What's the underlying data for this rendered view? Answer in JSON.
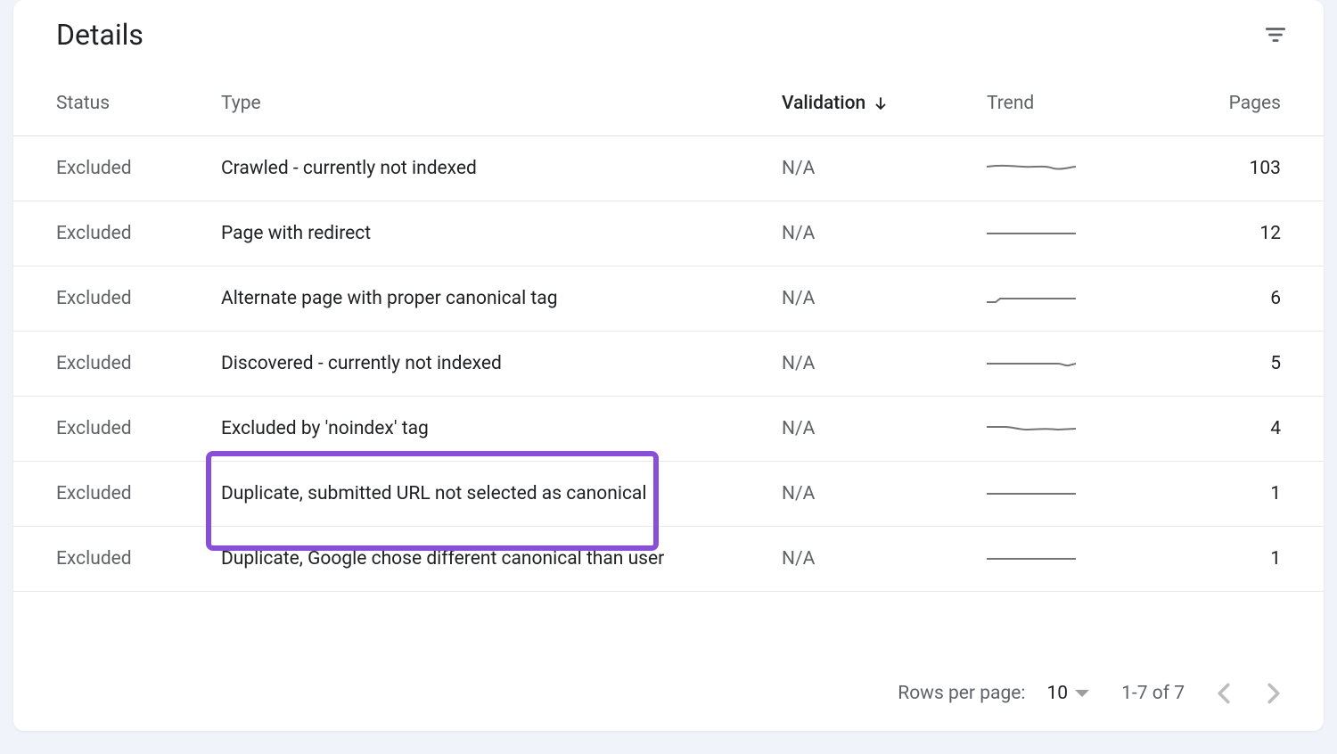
{
  "card": {
    "title": "Details"
  },
  "columns": {
    "status": "Status",
    "type": "Type",
    "validation": "Validation",
    "trend": "Trend",
    "pages": "Pages"
  },
  "rows": [
    {
      "status": "Excluded",
      "type": "Crawled - currently not indexed",
      "validation": "N/A",
      "pages": "103",
      "trend": "wavy",
      "highlighted": false
    },
    {
      "status": "Excluded",
      "type": "Page with redirect",
      "validation": "N/A",
      "pages": "12",
      "trend": "flat",
      "highlighted": false
    },
    {
      "status": "Excluded",
      "type": "Alternate page with proper canonical tag",
      "validation": "N/A",
      "pages": "6",
      "trend": "flat-start",
      "highlighted": false
    },
    {
      "status": "Excluded",
      "type": "Discovered - currently not indexed",
      "validation": "N/A",
      "pages": "5",
      "trend": "flat-bump",
      "highlighted": false
    },
    {
      "status": "Excluded",
      "type": "Excluded by 'noindex' tag",
      "validation": "N/A",
      "pages": "4",
      "trend": "wavy2",
      "highlighted": false
    },
    {
      "status": "Excluded",
      "type": "Duplicate, submitted URL not selected as canonical",
      "validation": "N/A",
      "pages": "1",
      "trend": "flat",
      "highlighted": true
    },
    {
      "status": "Excluded",
      "type": "Duplicate, Google chose different canonical than user",
      "validation": "N/A",
      "pages": "1",
      "trend": "flat",
      "highlighted": false
    }
  ],
  "footer": {
    "rows_per_page_label": "Rows per page:",
    "page_size": "10",
    "pagination_info": "1-7 of 7"
  },
  "colors": {
    "highlight": "#8a4fd8",
    "text_primary": "#202124",
    "text_secondary": "#5f6368"
  }
}
